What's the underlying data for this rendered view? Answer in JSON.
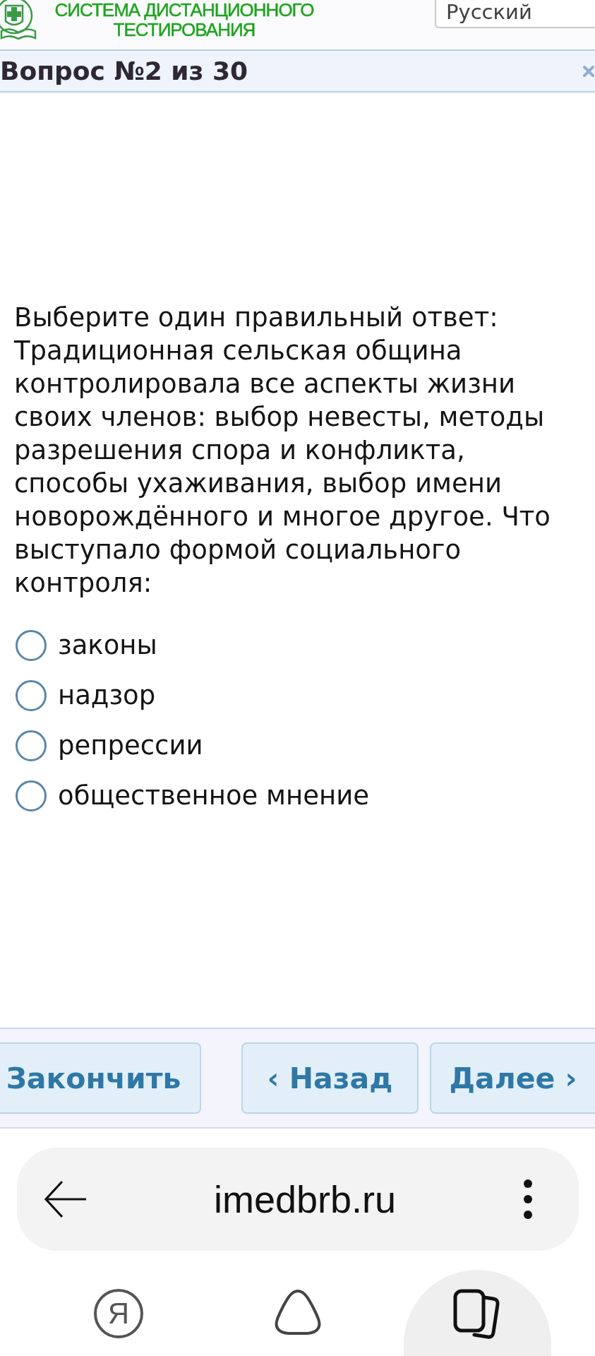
{
  "header": {
    "title_lines": [
      "СИСТЕМА ДИСТАНЦИОННОГО",
      "ТЕСТИРОВАНИЯ"
    ],
    "language_select": {
      "value": "Русский"
    }
  },
  "question_bar": {
    "title": "Вопрос №2 из 30"
  },
  "question": {
    "instruction": "Выберите один правильный ответ:",
    "text": "Традиционная сельская община контролировала все аспекты жизни своих членов: выбор невесты, методы разрешения спора и конфликта, способы ухаживания, выбор имени новорождённого и многое другое. Что выступало формой социального контроля:",
    "options": [
      {
        "label": "законы",
        "selected": false
      },
      {
        "label": "надзор",
        "selected": false
      },
      {
        "label": "репрессии",
        "selected": false
      },
      {
        "label": "общественное мнение",
        "selected": false
      }
    ]
  },
  "buttons": [
    {
      "label": "Закончить"
    },
    {
      "label": "‹ Назад"
    },
    {
      "label": "Далее ›"
    }
  ],
  "browser": {
    "url": "imedbrb.ru",
    "bottom_nav": [
      {
        "kind": "letter",
        "glyph": "Я",
        "selected": false
      },
      {
        "kind": "triangle",
        "selected": false
      },
      {
        "kind": "cards",
        "selected": true
      }
    ]
  }
}
